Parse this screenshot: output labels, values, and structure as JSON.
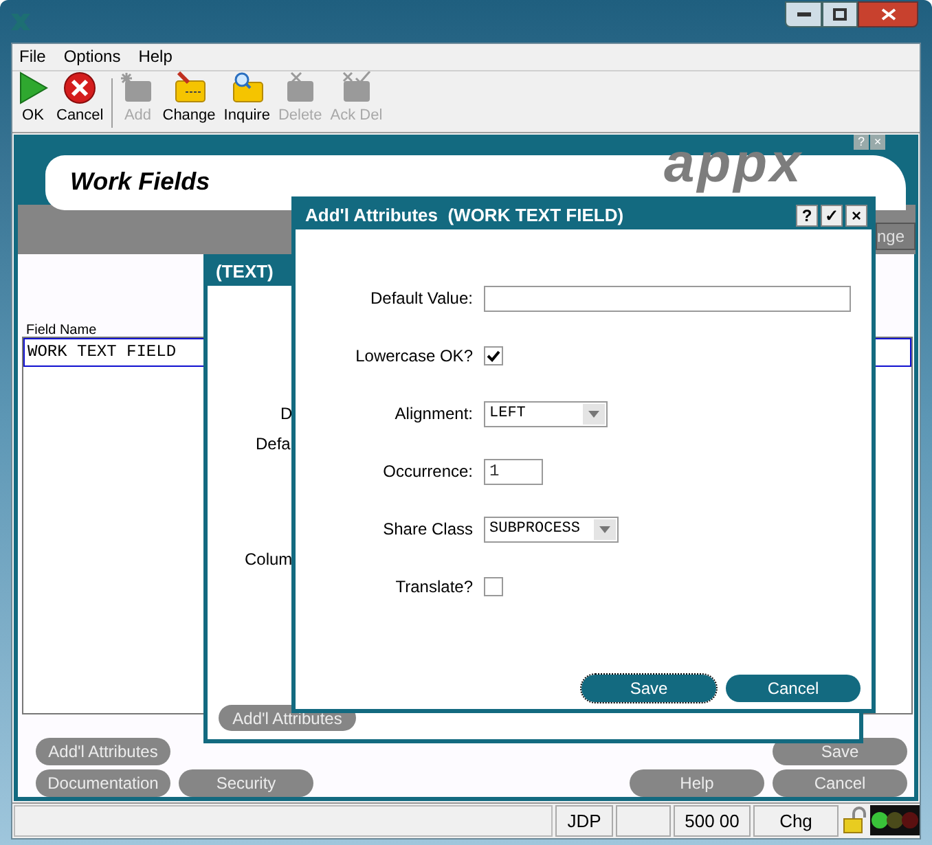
{
  "menu": [
    "File",
    "Options",
    "Help"
  ],
  "toolbar": [
    {
      "label": "OK",
      "kind": "ok",
      "disabled": false
    },
    {
      "label": "Cancel",
      "kind": "cancel",
      "disabled": false
    },
    {
      "label": "Add",
      "kind": "add",
      "disabled": true
    },
    {
      "label": "Change",
      "kind": "change",
      "disabled": false
    },
    {
      "label": "Inquire",
      "kind": "inquire",
      "disabled": false
    },
    {
      "label": "Delete",
      "kind": "delete",
      "disabled": true
    },
    {
      "label": "Ack Del",
      "kind": "ackdel",
      "disabled": true
    }
  ],
  "frame_buttons": [
    "?",
    "×"
  ],
  "form": {
    "title": "Work Fields",
    "logo": "appx",
    "partial_button": "nge",
    "field_label": "Field Name",
    "rows": [
      {
        "text": "WORK TEXT FIELD",
        "selected": true
      }
    ],
    "button_rows": [
      {
        "left": [
          "Add'l Attributes"
        ],
        "right": [
          "Save"
        ]
      },
      {
        "left": [
          "Documentation",
          "Security"
        ],
        "right": [
          "Help",
          "Cancel"
        ]
      }
    ]
  },
  "text_dialog": {
    "title": "(TEXT)",
    "labels": [
      "D",
      "Defa",
      "Colum"
    ],
    "button": "Add'l Attributes"
  },
  "attributes_dialog": {
    "title": "Add'l Attributes  (WORK TEXT FIELD)",
    "title_buttons": [
      "?",
      "✓",
      "×"
    ],
    "fields": [
      {
        "kind": "text",
        "label": "Default Value:"
      },
      {
        "kind": "checkbox",
        "label": "Lowercase OK?",
        "checked": true
      },
      {
        "kind": "select",
        "label": "Alignment:",
        "value": "LEFT"
      },
      {
        "kind": "text",
        "label": "Occurrence:",
        "value": "1"
      },
      {
        "kind": "select",
        "label": "Share Class",
        "value": "SUBPROCESS"
      },
      {
        "kind": "checkbox",
        "label": "Translate?",
        "checked": false
      }
    ],
    "buttons": [
      {
        "label": "Save",
        "focused": true
      },
      {
        "label": "Cancel",
        "focused": false
      }
    ]
  },
  "status_bar": {
    "user": "JDP",
    "amount": "500 00",
    "mode": "Chg"
  }
}
